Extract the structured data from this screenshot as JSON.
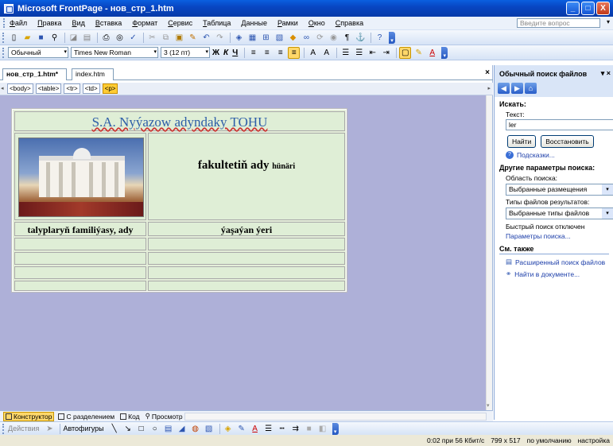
{
  "window": {
    "title": "Microsoft FrontPage - нов_стр_1.htm",
    "min": "_",
    "max": "□",
    "close": "X"
  },
  "menubar": {
    "items": [
      "Файл",
      "Правка",
      "Вид",
      "Вставка",
      "Формат",
      "Сервис",
      "Таблица",
      "Данные",
      "Рамки",
      "Окно",
      "Справка"
    ],
    "ask_placeholder": "Введите вопрос"
  },
  "formatting": {
    "style": "Обычный",
    "font": "Times New Roman",
    "size": "3 (12 пт)"
  },
  "doc_tabs": {
    "tabs": [
      "нов_стр_1.htm*",
      "index.htm"
    ],
    "close": "×"
  },
  "tags": [
    "<body>",
    "<table>",
    "<tr>",
    "<td>",
    "<p>"
  ],
  "page": {
    "title": "S.A. Nyýazow adyndaky TOHU",
    "faculty_main": "fakultetiň ady",
    "faculty_small": "hünäri",
    "col1_header": "talyplaryň familiýasy, ady",
    "col2_header": "ýaşaýan ýeri"
  },
  "view_tabs": [
    "Конструктор",
    "С разделением",
    "Код",
    "Просмотр"
  ],
  "drawing": {
    "actions": "Действия",
    "autoshapes": "Автофигуры"
  },
  "status": {
    "speed": "0:02 при 56 Кбит/с",
    "resolution": "799 x 517",
    "default": "по умолчанию",
    "settings": "настройка"
  },
  "taskpane": {
    "title": "Обычный поиск файлов",
    "search_heading": "Искать:",
    "text_label": "Текст:",
    "text_value": "ler",
    "find_button": "Найти",
    "restore_button": "Восстановить",
    "hints_link": "Подсказки...",
    "other_heading": "Другие параметры поиска:",
    "scope_label": "Область поиска:",
    "scope_value": "Выбранные размещения",
    "types_label": "Типы файлов результатов:",
    "types_value": "Выбранные типы файлов",
    "fast_search": "Быстрый поиск отключен",
    "params_link": "Параметры поиска...",
    "see_also": "См. также",
    "advanced_link": "Расширенный поиск файлов",
    "find_in_doc_link": "Найти в документе..."
  }
}
